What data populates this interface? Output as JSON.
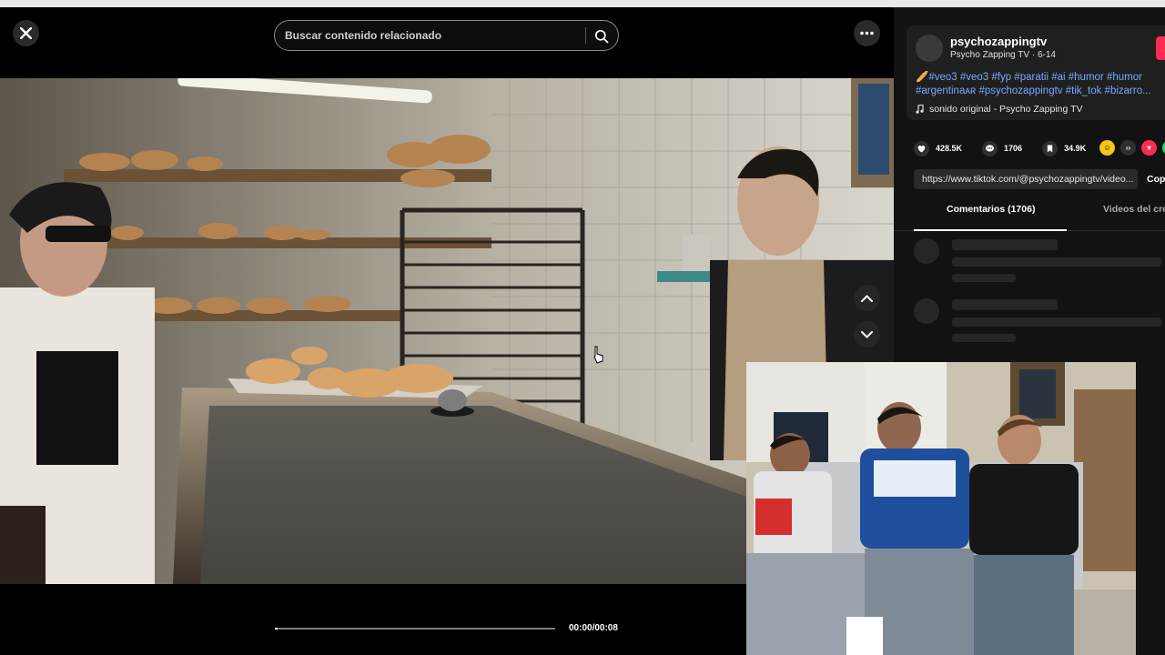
{
  "player": {
    "search_placeholder": "Buscar contenido relacionado",
    "time": "00:00/00:08",
    "progress_fraction": 0.01
  },
  "icons": {
    "close": "close-icon",
    "search": "search-icon",
    "more": "more-dots-icon",
    "prev": "chevron-up-icon",
    "next": "chevron-down-icon"
  },
  "side": {
    "username": "psychozappingtv",
    "subtitle": "Psycho Zapping TV · 6-14",
    "desc_line1": "🥖#veo3 #veo3 #fyp #paratii #ai #humor #humor",
    "desc_line2": "#argentinaᴀʀ #psychozappingtv #tik_tok #bizarro...",
    "sound": "sonido original - Psycho Zapping TV",
    "likes": "428.5K",
    "comments": "1706",
    "saves": "34.9K",
    "link": "https://www.tiktok.com/@psychozappingtv/video...",
    "copy": "Cop",
    "tab_comments": "Comentarios (1706)",
    "tab_videos": "Videos del cre"
  },
  "colors": {
    "accent": "#fe2c55",
    "hashtag": "#79a8ff",
    "panel": "#121212"
  }
}
